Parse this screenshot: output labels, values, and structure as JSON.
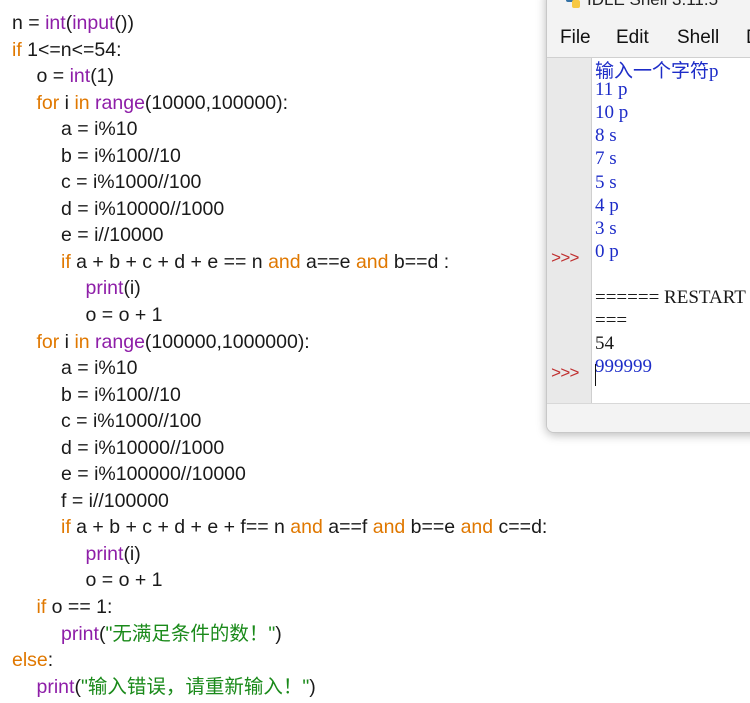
{
  "code": {
    "lines": [
      {
        "indent": 0,
        "tokens": [
          {
            "t": "n = ",
            "c": "pl"
          },
          {
            "t": "int",
            "c": "bi"
          },
          {
            "t": "(",
            "c": "pl"
          },
          {
            "t": "input",
            "c": "bi"
          },
          {
            "t": "())",
            "c": "pl"
          }
        ]
      },
      {
        "indent": 0,
        "tokens": [
          {
            "t": "if",
            "c": "kw"
          },
          {
            "t": " 1<=n<=54:",
            "c": "pl"
          }
        ]
      },
      {
        "indent": 1,
        "tokens": [
          {
            "t": "o = ",
            "c": "pl"
          },
          {
            "t": "int",
            "c": "bi"
          },
          {
            "t": "(1)",
            "c": "pl"
          }
        ]
      },
      {
        "indent": 1,
        "tokens": [
          {
            "t": "for",
            "c": "kw"
          },
          {
            "t": " i ",
            "c": "pl"
          },
          {
            "t": "in",
            "c": "kw"
          },
          {
            "t": " ",
            "c": "pl"
          },
          {
            "t": "range",
            "c": "bi"
          },
          {
            "t": "(10000,100000):",
            "c": "pl"
          }
        ]
      },
      {
        "indent": 2,
        "tokens": [
          {
            "t": "a = i%10",
            "c": "pl"
          }
        ]
      },
      {
        "indent": 2,
        "tokens": [
          {
            "t": "b = i%100//10",
            "c": "pl"
          }
        ]
      },
      {
        "indent": 2,
        "tokens": [
          {
            "t": "c = i%1000//100",
            "c": "pl"
          }
        ]
      },
      {
        "indent": 2,
        "tokens": [
          {
            "t": "d = i%10000//1000",
            "c": "pl"
          }
        ]
      },
      {
        "indent": 2,
        "tokens": [
          {
            "t": "e = i//10000",
            "c": "pl"
          }
        ]
      },
      {
        "indent": 2,
        "tokens": [
          {
            "t": "if",
            "c": "kw"
          },
          {
            "t": " a + b + c + d + e == n ",
            "c": "pl"
          },
          {
            "t": "and",
            "c": "kw"
          },
          {
            "t": " a==e ",
            "c": "pl"
          },
          {
            "t": "and",
            "c": "kw"
          },
          {
            "t": " b==d :",
            "c": "pl"
          }
        ]
      },
      {
        "indent": 3,
        "tokens": [
          {
            "t": "print",
            "c": "bi"
          },
          {
            "t": "(i)",
            "c": "pl"
          }
        ]
      },
      {
        "indent": 3,
        "tokens": [
          {
            "t": "o = o + 1",
            "c": "pl"
          }
        ]
      },
      {
        "indent": 1,
        "tokens": [
          {
            "t": "for",
            "c": "kw"
          },
          {
            "t": " i ",
            "c": "pl"
          },
          {
            "t": "in",
            "c": "kw"
          },
          {
            "t": " ",
            "c": "pl"
          },
          {
            "t": "range",
            "c": "bi"
          },
          {
            "t": "(100000,1000000):",
            "c": "pl"
          }
        ]
      },
      {
        "indent": 2,
        "tokens": [
          {
            "t": "a = i%10",
            "c": "pl"
          }
        ]
      },
      {
        "indent": 2,
        "tokens": [
          {
            "t": "b = i%100//10",
            "c": "pl"
          }
        ]
      },
      {
        "indent": 2,
        "tokens": [
          {
            "t": "c = i%1000//100",
            "c": "pl"
          }
        ]
      },
      {
        "indent": 2,
        "tokens": [
          {
            "t": "d = i%10000//1000",
            "c": "pl"
          }
        ]
      },
      {
        "indent": 2,
        "tokens": [
          {
            "t": "e = i%100000//10000",
            "c": "pl"
          }
        ]
      },
      {
        "indent": 2,
        "tokens": [
          {
            "t": "f = i//100000",
            "c": "pl"
          }
        ]
      },
      {
        "indent": 2,
        "tokens": [
          {
            "t": "if",
            "c": "kw"
          },
          {
            "t": " a + b + c + d + e + f== n ",
            "c": "pl"
          },
          {
            "t": "and",
            "c": "kw"
          },
          {
            "t": " a==f ",
            "c": "pl"
          },
          {
            "t": "and",
            "c": "kw"
          },
          {
            "t": " b==e ",
            "c": "pl"
          },
          {
            "t": "and",
            "c": "kw"
          },
          {
            "t": " c==d:",
            "c": "pl"
          }
        ]
      },
      {
        "indent": 3,
        "tokens": [
          {
            "t": "print",
            "c": "bi"
          },
          {
            "t": "(i)",
            "c": "pl"
          }
        ]
      },
      {
        "indent": 3,
        "tokens": [
          {
            "t": "o = o + 1",
            "c": "pl"
          }
        ]
      },
      {
        "indent": 1,
        "tokens": [
          {
            "t": "if",
            "c": "kw"
          },
          {
            "t": " o == 1:",
            "c": "pl"
          }
        ]
      },
      {
        "indent": 2,
        "tokens": [
          {
            "t": "print",
            "c": "bi"
          },
          {
            "t": "(",
            "c": "pl"
          },
          {
            "t": "\"无满足条件的数！\"",
            "c": "str"
          },
          {
            "t": ")",
            "c": "pl"
          }
        ]
      },
      {
        "indent": 0,
        "tokens": [
          {
            "t": "else",
            "c": "kw"
          },
          {
            "t": ":",
            "c": "pl"
          }
        ]
      },
      {
        "indent": 1,
        "tokens": [
          {
            "t": "print",
            "c": "bi"
          },
          {
            "t": "(",
            "c": "pl"
          },
          {
            "t": "\"输入错误，请重新输入！\"",
            "c": "str"
          },
          {
            "t": ")",
            "c": "pl"
          }
        ]
      }
    ]
  },
  "idle": {
    "title": "IDLE Shell 3.11.5",
    "menu": [
      "File",
      "Edit",
      "Shell",
      "D"
    ],
    "prompt": ">>>",
    "output": [
      {
        "text": "输入一个字符p",
        "color": "blue"
      },
      {
        "text": "11 p",
        "color": "blue"
      },
      {
        "text": "10 p",
        "color": "blue"
      },
      {
        "text": "8 s",
        "color": "blue"
      },
      {
        "text": "7 s",
        "color": "blue"
      },
      {
        "text": "5 s",
        "color": "blue"
      },
      {
        "text": "4 p",
        "color": "blue"
      },
      {
        "text": "3 s",
        "color": "blue"
      },
      {
        "text": "0 p",
        "color": "blue"
      },
      {
        "text": "",
        "color": "dark"
      },
      {
        "text": "====== RESTART",
        "color": "dark"
      },
      {
        "text": "===",
        "color": "dark"
      },
      {
        "text": "54",
        "color": "dark"
      },
      {
        "text": "999999",
        "color": "blue"
      }
    ]
  },
  "colors": {
    "keyword": "#e07800",
    "builtin": "#8e1ea8",
    "string": "#1a8a1a",
    "shell_output": "#1d2cc8",
    "prompt": "#c03030"
  }
}
